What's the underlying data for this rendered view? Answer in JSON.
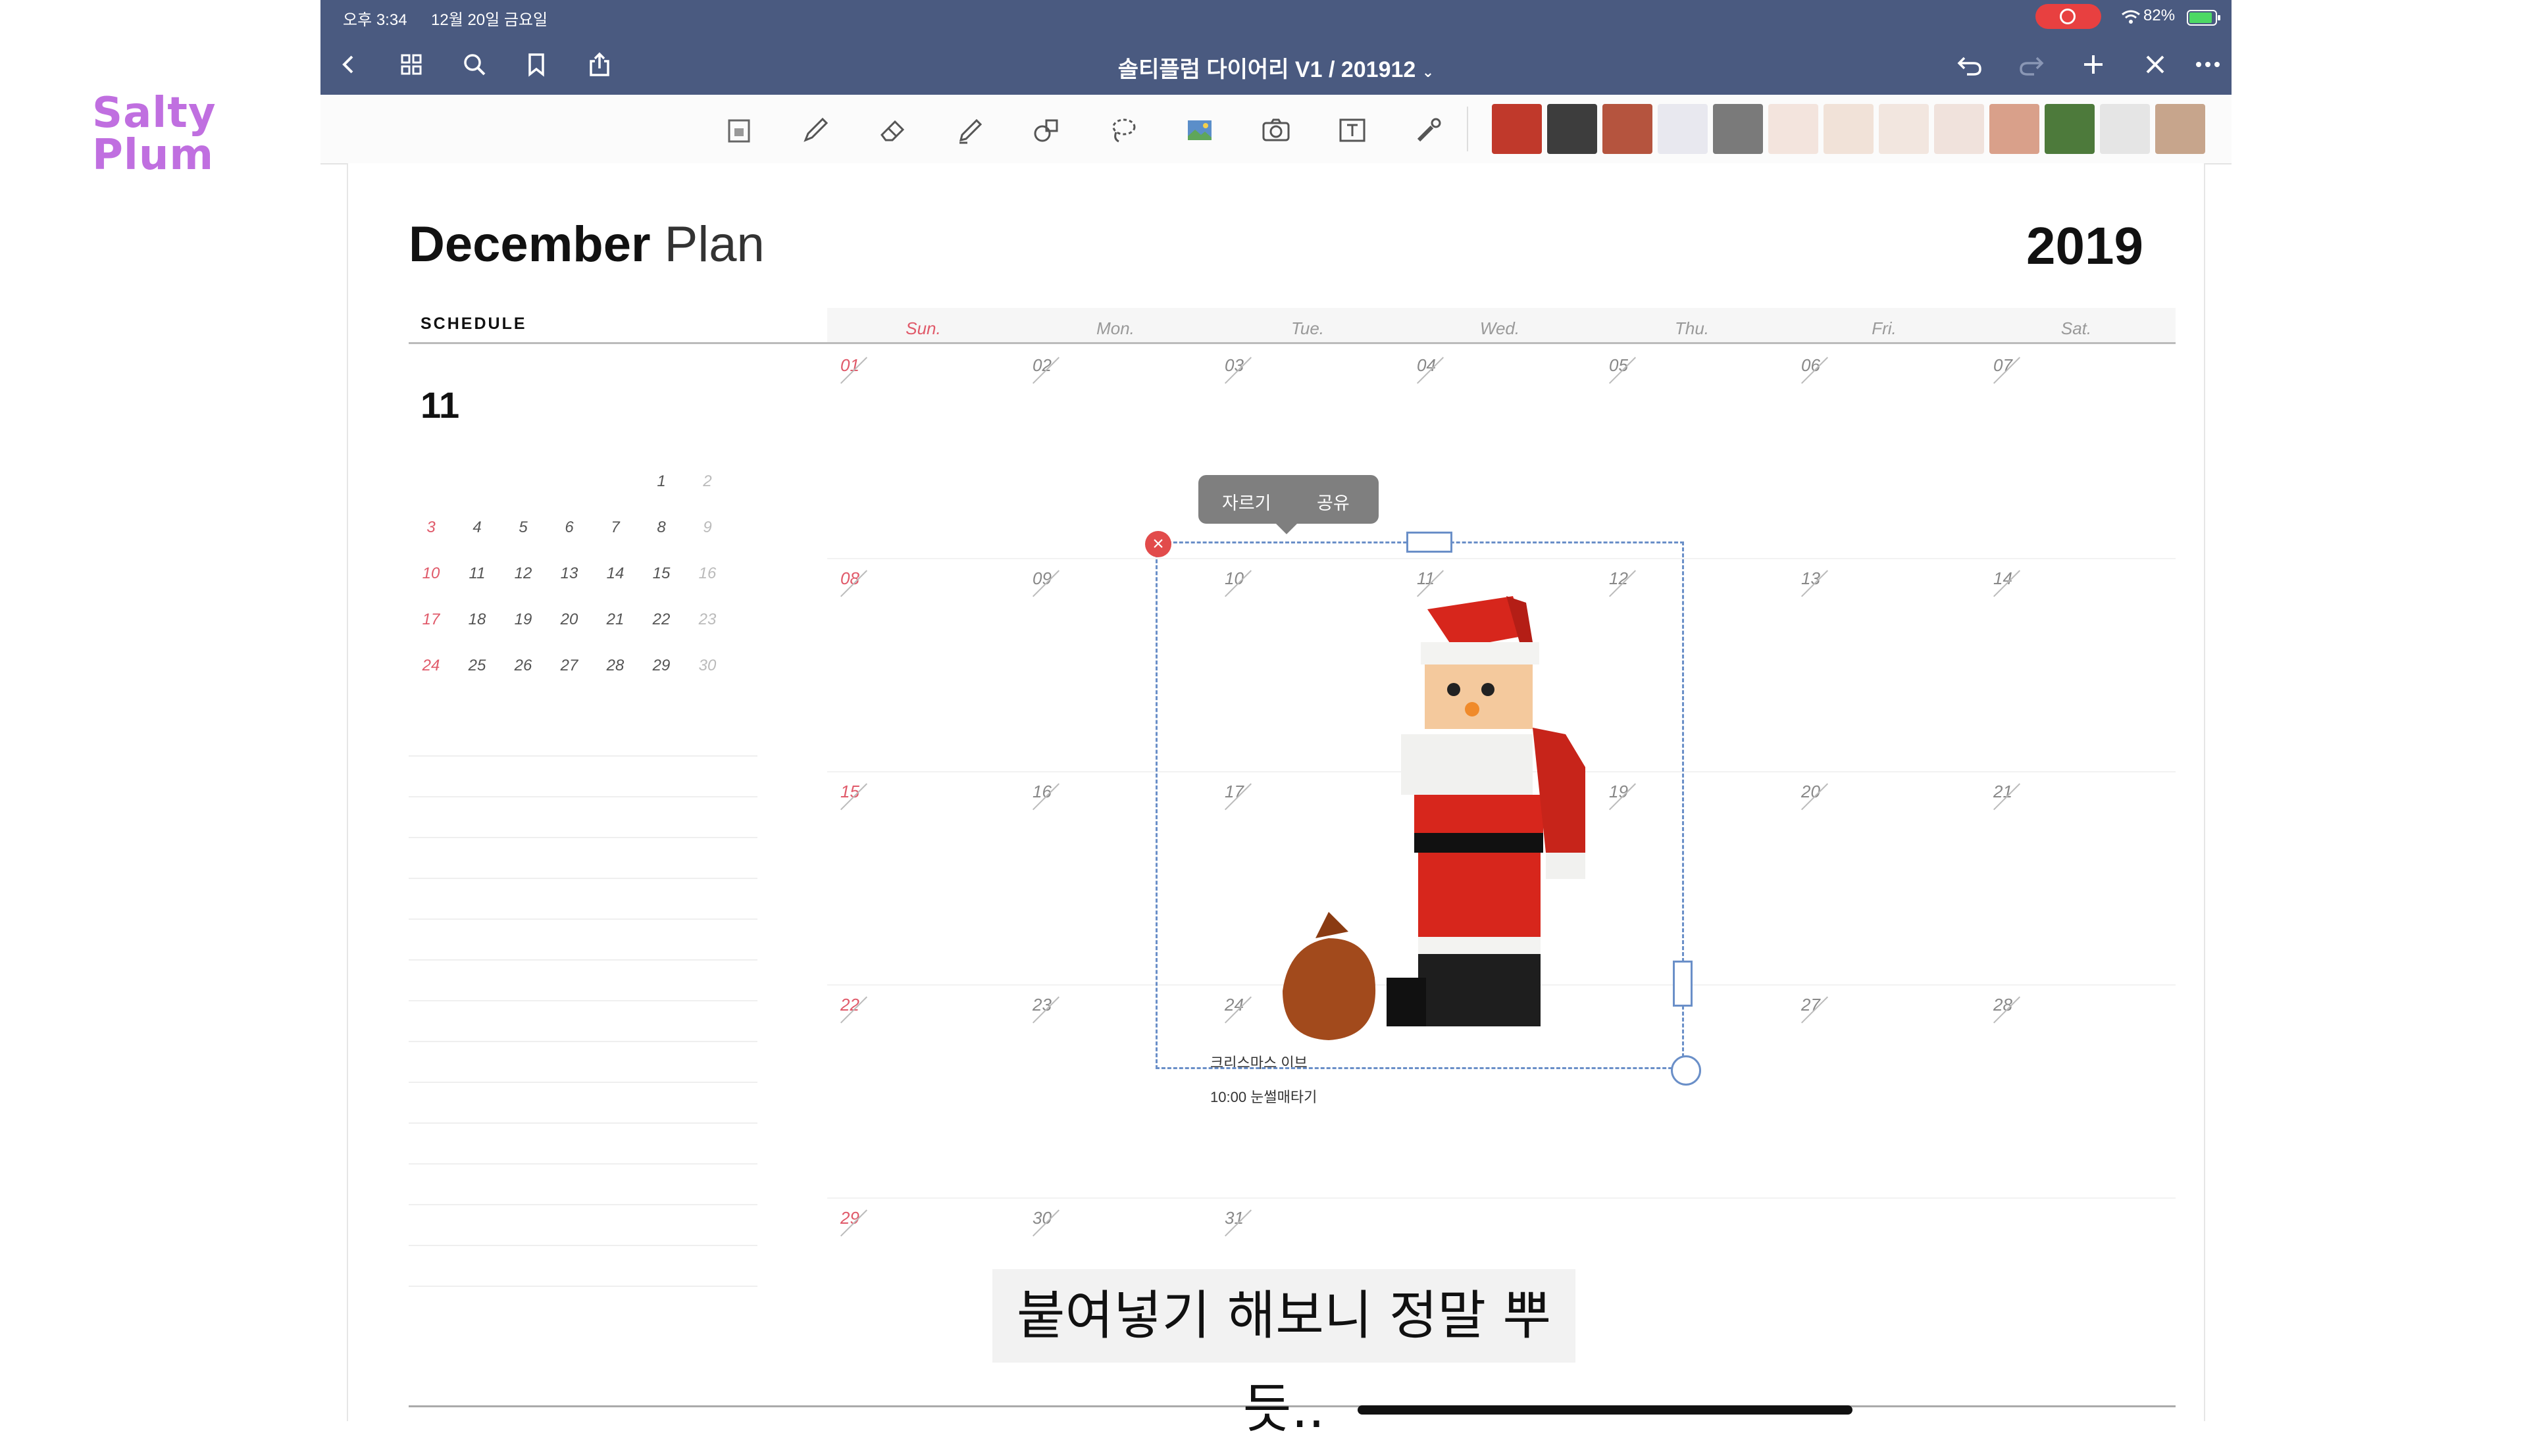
{
  "watermark": {
    "line1": "Salty",
    "line2": "Plum"
  },
  "status_bar": {
    "time": "오후 3:34",
    "date": "12월 20일 금요일",
    "battery": "82%"
  },
  "nav": {
    "document_title": "솔티플럼 다이어리 V1 / 201912"
  },
  "toolbar_tools": [
    "page-thumbnail-icon",
    "pen-icon",
    "eraser-icon",
    "highlighter-icon",
    "shapes-icon",
    "lasso-icon",
    "image-icon",
    "camera-icon",
    "textbox-icon",
    "laser-pointer-icon"
  ],
  "sticker_colors": [
    "#c0392b",
    "#3d3d3d",
    "#b5543e",
    "#e8e8ef",
    "#7a7a7a",
    "#f3e4dd",
    "#f1e2d8",
    "#f2e6df",
    "#f0e2dc",
    "#d9a08a",
    "#4d7a3b",
    "#e5e5e5",
    "#c7a58c"
  ],
  "page": {
    "title_bold": "December",
    "title_light": "Plan",
    "year": "2019",
    "schedule_label": "SCHEDULE",
    "mini_month": "11",
    "mini_calendar": [
      [
        "",
        "",
        "",
        "",
        "",
        "1",
        "2"
      ],
      [
        "3",
        "4",
        "5",
        "6",
        "7",
        "8",
        "9"
      ],
      [
        "10",
        "11",
        "12",
        "13",
        "14",
        "15",
        "16"
      ],
      [
        "17",
        "18",
        "19",
        "20",
        "21",
        "22",
        "23"
      ],
      [
        "24",
        "25",
        "26",
        "27",
        "28",
        "29",
        "30"
      ]
    ],
    "day_names": [
      "Sun.",
      "Mon.",
      "Tue.",
      "Wed.",
      "Thu.",
      "Fri.",
      "Sat."
    ],
    "weeks": [
      [
        "01",
        "02",
        "03",
        "04",
        "05",
        "06",
        "07"
      ],
      [
        "08",
        "09",
        "10",
        "11",
        "12",
        "13",
        "14"
      ],
      [
        "15",
        "16",
        "17",
        "",
        "19",
        "20",
        "21"
      ],
      [
        "22",
        "23",
        "24",
        "",
        "",
        "27",
        "28"
      ],
      [
        "29",
        "30",
        "31",
        "",
        "",
        "",
        ""
      ]
    ],
    "memo_line1": "크리스마스 이브",
    "memo_line2": "10:00 눈썰매타기"
  },
  "selection": {
    "crop_label": "자르기",
    "share_label": "공유"
  },
  "subtitle": "붙여넣기 해보니 정말 뿌듯..",
  "colors": {
    "nav_bg": "#4a5a80",
    "sunday_red": "#e05a6a",
    "accent": "#6a8fc8"
  }
}
